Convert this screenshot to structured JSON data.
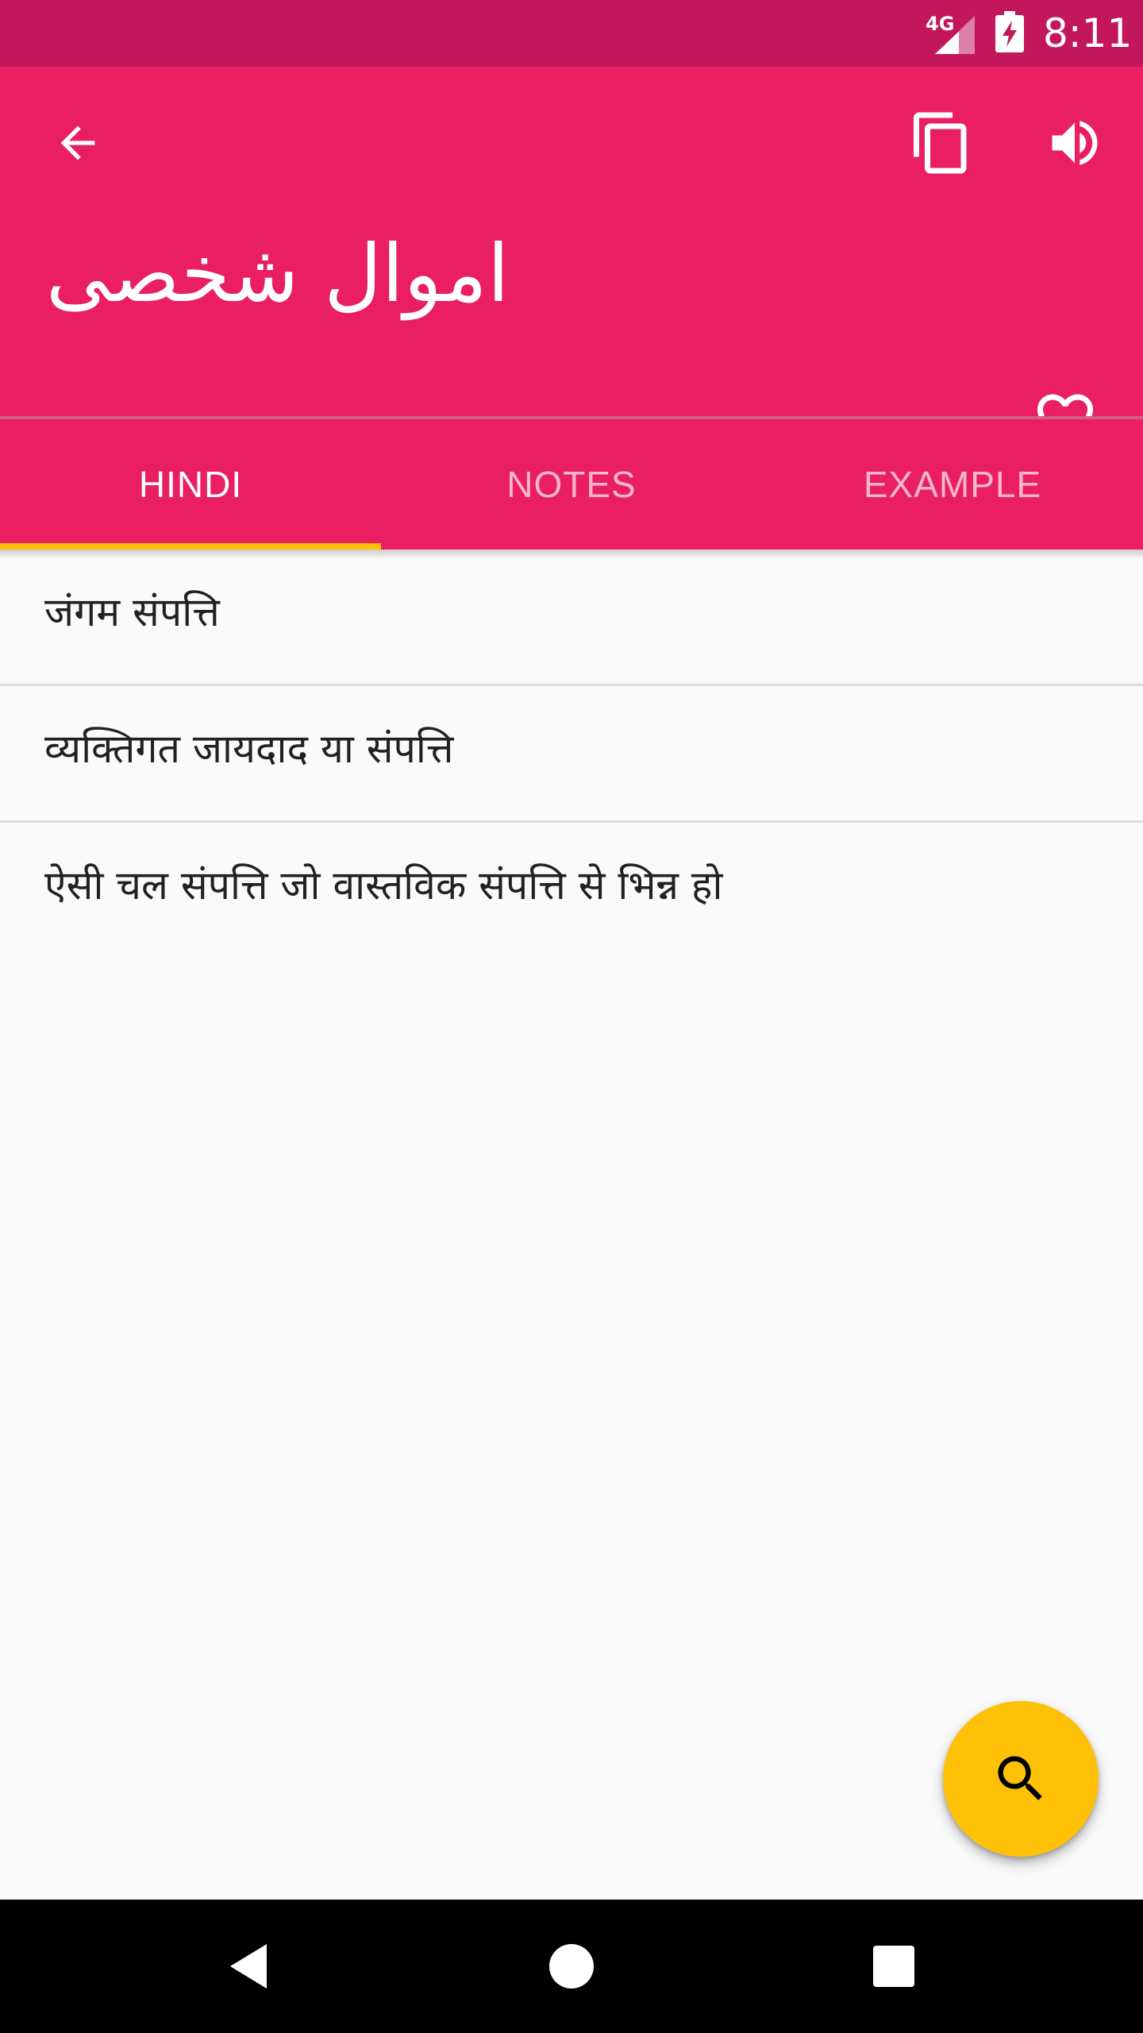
{
  "status_bar": {
    "network": "4G",
    "time": "8:11"
  },
  "app_bar": {
    "title": "اموال شخصی",
    "icons": {
      "back": "arrow-back-icon",
      "copy": "copy-icon",
      "sound": "volume-up-icon",
      "favorite": "heart-outline-icon"
    }
  },
  "tabs": [
    {
      "label": "HINDI",
      "active": true
    },
    {
      "label": "NOTES",
      "active": false
    },
    {
      "label": "EXAMPLE",
      "active": false
    }
  ],
  "meanings": [
    {
      "text": "जंगम संपत्ति"
    },
    {
      "text": "व्यक्तिगत जायदाद या संपत्ति"
    },
    {
      "text": "ऐसी चल संपत्ति जो वास्तविक संपत्ति से भिन्न हो"
    }
  ],
  "fab": {
    "icon": "search-icon"
  },
  "navigation": {
    "back": "nav-back-icon",
    "home": "nav-home-icon",
    "recents": "nav-recents-icon"
  },
  "colors": {
    "primary": "#e91e63",
    "primary_dark": "#c2185b",
    "accent": "#ffc107",
    "background": "#fafafa"
  }
}
